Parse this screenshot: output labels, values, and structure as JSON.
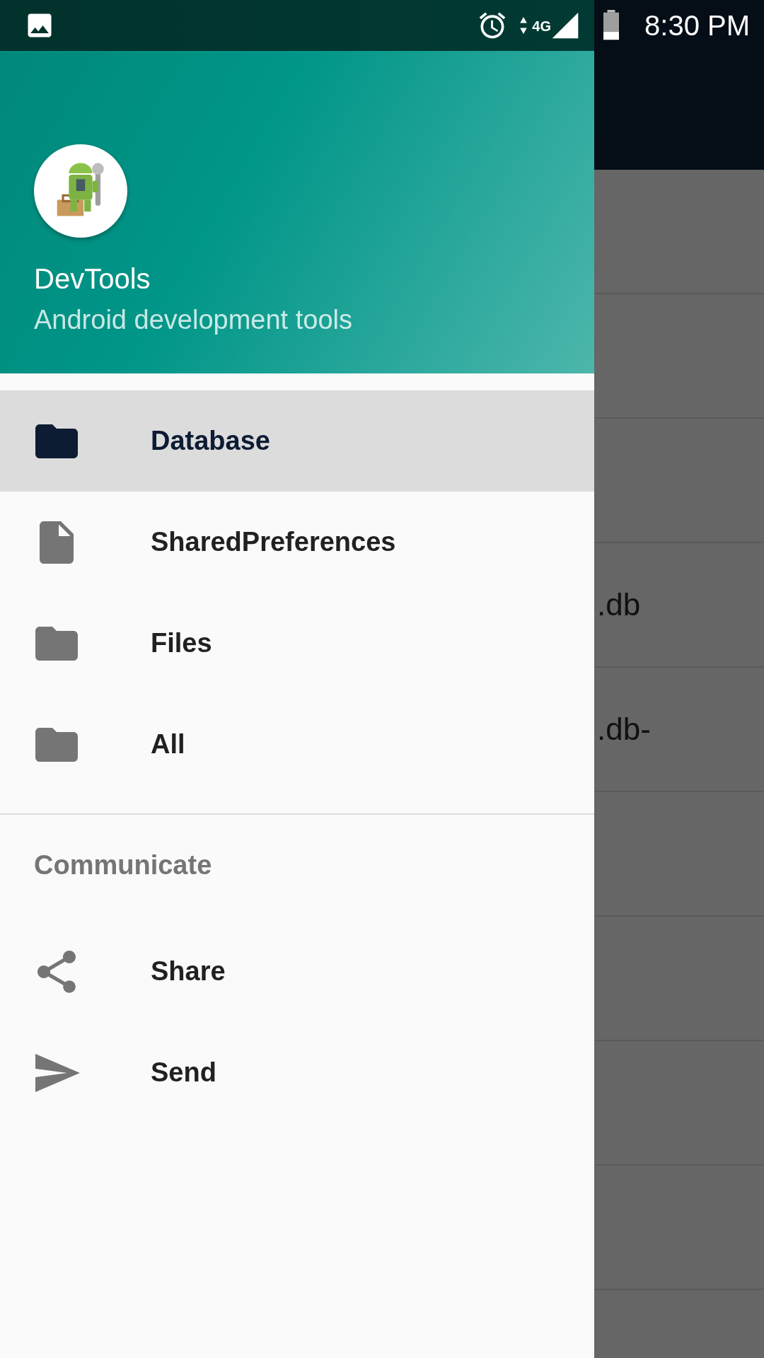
{
  "status_bar": {
    "network": "4G",
    "time": "8:30 PM"
  },
  "header": {
    "title": "DevTools",
    "subtitle": "Android development tools"
  },
  "menu": [
    {
      "label": "Database",
      "kind": "folder",
      "selected": true
    },
    {
      "label": "SharedPreferences",
      "kind": "file",
      "selected": false
    },
    {
      "label": "Files",
      "kind": "folder",
      "selected": false
    },
    {
      "label": "All",
      "kind": "folder",
      "selected": false
    }
  ],
  "section": {
    "title": "Communicate",
    "items": [
      {
        "label": "Share",
        "kind": "share"
      },
      {
        "label": "Send",
        "kind": "send"
      }
    ]
  },
  "background_list": {
    "rows": [
      {
        "kind": "blank"
      },
      {
        "kind": "blank"
      },
      {
        "kind": "blank"
      },
      {
        "kind": "text",
        "text": ".db"
      },
      {
        "kind": "text",
        "text": ".db-"
      },
      {
        "kind": "blank"
      },
      {
        "kind": "blank"
      },
      {
        "kind": "blank"
      },
      {
        "kind": "blank"
      }
    ]
  }
}
